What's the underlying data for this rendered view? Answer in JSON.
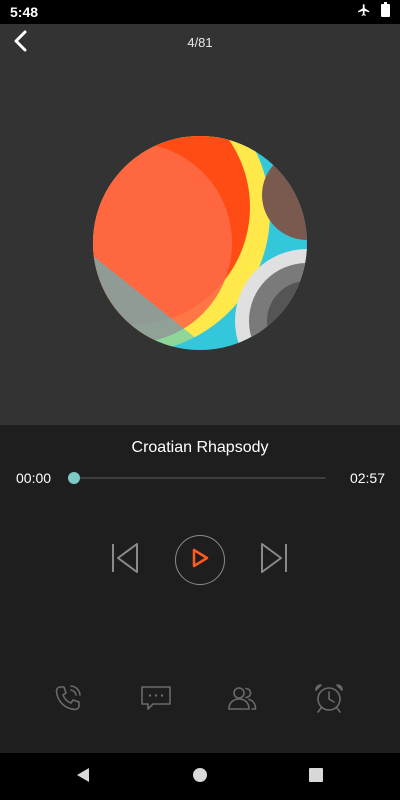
{
  "status_bar": {
    "time": "5:48",
    "icons": [
      "airplane-icon",
      "battery-icon"
    ]
  },
  "header": {
    "track_counter": "4/81",
    "back_icon": "chevron-left-icon"
  },
  "now_playing": {
    "title": "Croatian Rhapsody",
    "current_time": "00:00",
    "total_time": "02:57",
    "progress": 0.0,
    "accent_color": "#7fc9c6",
    "play_icon_color": "#ff5a1f"
  },
  "controls": {
    "previous_icon": "skip-previous-icon",
    "play_icon": "play-icon",
    "next_icon": "skip-next-icon"
  },
  "bottom_actions": [
    "phone-ringing-icon",
    "message-icon",
    "contacts-icon",
    "alarm-clock-icon"
  ],
  "nav_bar": [
    "back-triangle-icon",
    "home-circle-icon",
    "recents-square-icon"
  ],
  "colors": {
    "hero_bg": "#333333",
    "player_bg": "#1e1e1e",
    "art": [
      "#ff4c14",
      "#ffe94a",
      "#34c6da",
      "#7a5a4e",
      "#e0e0e0"
    ]
  }
}
